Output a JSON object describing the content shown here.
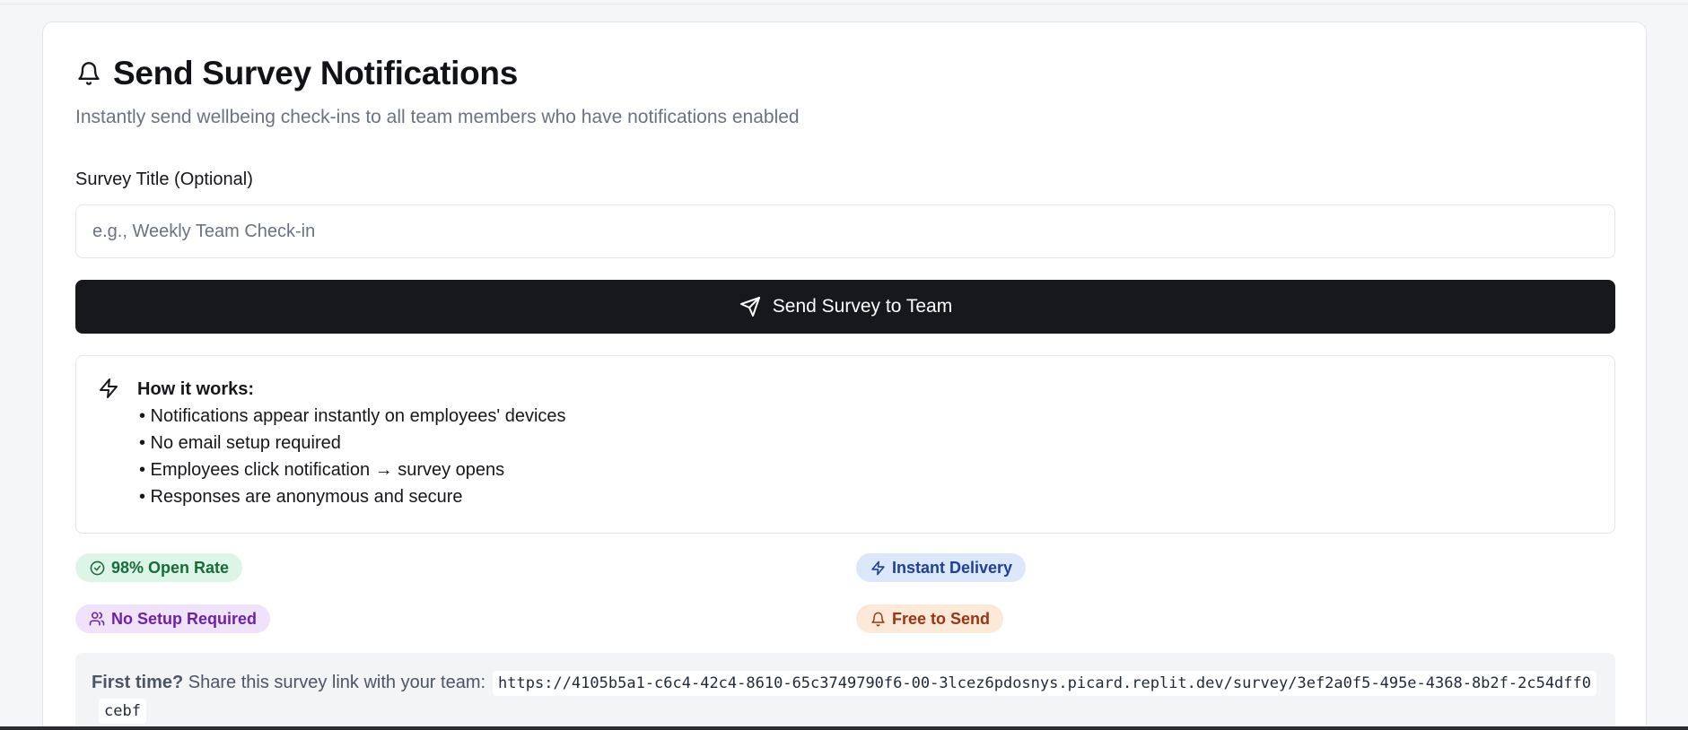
{
  "card": {
    "title": "Send Survey Notifications",
    "title_icon": "bell-icon",
    "subtitle": "Instantly send wellbeing check-ins to all team members who have notifications enabled"
  },
  "form": {
    "field_label": "Survey Title (Optional)",
    "input_value": "",
    "input_placeholder": "e.g., Weekly Team Check-in",
    "send_button_label": "Send Survey to Team",
    "send_button_icon": "send-icon"
  },
  "how_it_works": {
    "icon": "zap-icon",
    "title": "How it works:",
    "items": [
      "• Notifications appear instantly on employees' devices",
      "• No email setup required",
      "• Employees click notification → survey opens",
      "• Responses are anonymous and secure"
    ]
  },
  "badges": [
    {
      "label": "98% Open Rate",
      "icon": "check-circle-icon",
      "color": "#176b3a",
      "background": "#dcf5e6"
    },
    {
      "label": "Instant Delivery",
      "icon": "zap-icon",
      "color": "#1e3f9a",
      "background": "#dbe7fb"
    },
    {
      "label": "No Setup Required",
      "icon": "users-icon",
      "color": "#6b21a8",
      "background": "#f1e2fb"
    },
    {
      "label": "Free to Send",
      "icon": "bell-icon",
      "color": "#9a3412",
      "background": "#fde9d8"
    }
  ],
  "first_time": {
    "lead": "First time?",
    "text": " Share this survey link with your team:",
    "link": "https://4105b5a1-c6c4-42c4-8610-65c3749790f6-00-3lcez6pdosnys.picard.replit.dev/survey/3ef2a0f5-495e-4368-8b2f-2c54dff0cebf"
  },
  "colors": {
    "primary_button": "#17181b",
    "muted_text": "#6b7280",
    "border": "#e3e5e9"
  }
}
